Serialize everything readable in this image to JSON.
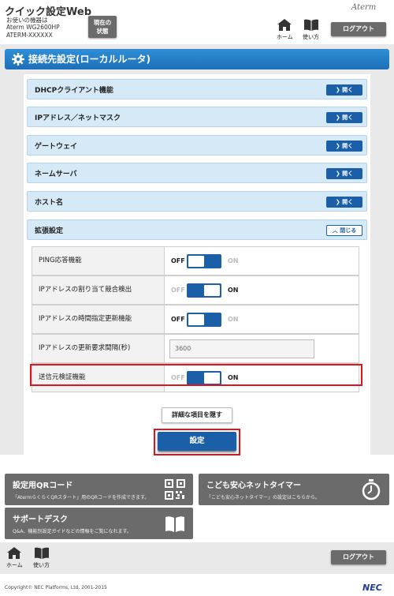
{
  "header": {
    "app_title": "クイック設定Web",
    "device_caption": "お使いの機器は",
    "device_model": "Aterm WG2600HP",
    "device_id": "ATERM-XXXXXX",
    "state_button": [
      "現在の",
      "状態"
    ],
    "brand": "Aterm",
    "home_label": "ホーム",
    "help_label": "使い方",
    "logout_label": "ログアウト"
  },
  "page": {
    "title": "接続先設定(ローカルルータ)"
  },
  "sections": [
    {
      "label": "DHCPクライアント機能",
      "button": "開く"
    },
    {
      "label": "IPアドレス／ネットマスク",
      "button": "開く"
    },
    {
      "label": "ゲートウェイ",
      "button": "開く"
    },
    {
      "label": "ネームサーバ",
      "button": "開く"
    },
    {
      "label": "ホスト名",
      "button": "開く"
    },
    {
      "label": "拡張設定",
      "button": "閉じる"
    }
  ],
  "settings": [
    {
      "name": "PING応答機能",
      "state": "OFF",
      "off": "OFF",
      "on": "ON"
    },
    {
      "name": "IPアドレスの割り当て競合検出",
      "state": "ON",
      "off": "OFF",
      "on": "ON"
    },
    {
      "name": "IPアドレスの時間指定更新機能",
      "state": "OFF",
      "off": "OFF",
      "on": "ON"
    },
    {
      "name": "IPアドレスの更新要求間隔(秒)",
      "value": "3600"
    },
    {
      "name": "送信元検証機能",
      "state": "ON",
      "off": "OFF",
      "on": "ON"
    }
  ],
  "buttons": {
    "hide_details": "詳細な項目を隠す",
    "submit": "設定"
  },
  "tiles": [
    {
      "title": "設定用QRコード",
      "desc": "「AtermらくらくQRスタート」用のQRコードを作成できます。",
      "icon": "qr-code-icon"
    },
    {
      "title": "こども安心ネットタイマー",
      "desc": "「こども安心ネットタイマー」の設定はこちらから。",
      "icon": "stopwatch-icon"
    },
    {
      "title": "サポートデスク",
      "desc": "Q&A、機能別設定ガイドなどの情報をご覧になれます。",
      "icon": "book-icon"
    }
  ],
  "footer": {
    "home_label": "ホーム",
    "help_label": "使い方",
    "logout_label": "ログアウト",
    "copyright": "Copyright© NEC Platforms, Ltd. 2001-2015",
    "nec_logo": "NEC"
  },
  "colors": {
    "accent": "#1a5fa8",
    "title_bar": "#2f8fd6",
    "section_bg": "#d6e9f7",
    "highlight_red": "#e0141e",
    "tile_gray": "#6b6b6b"
  }
}
